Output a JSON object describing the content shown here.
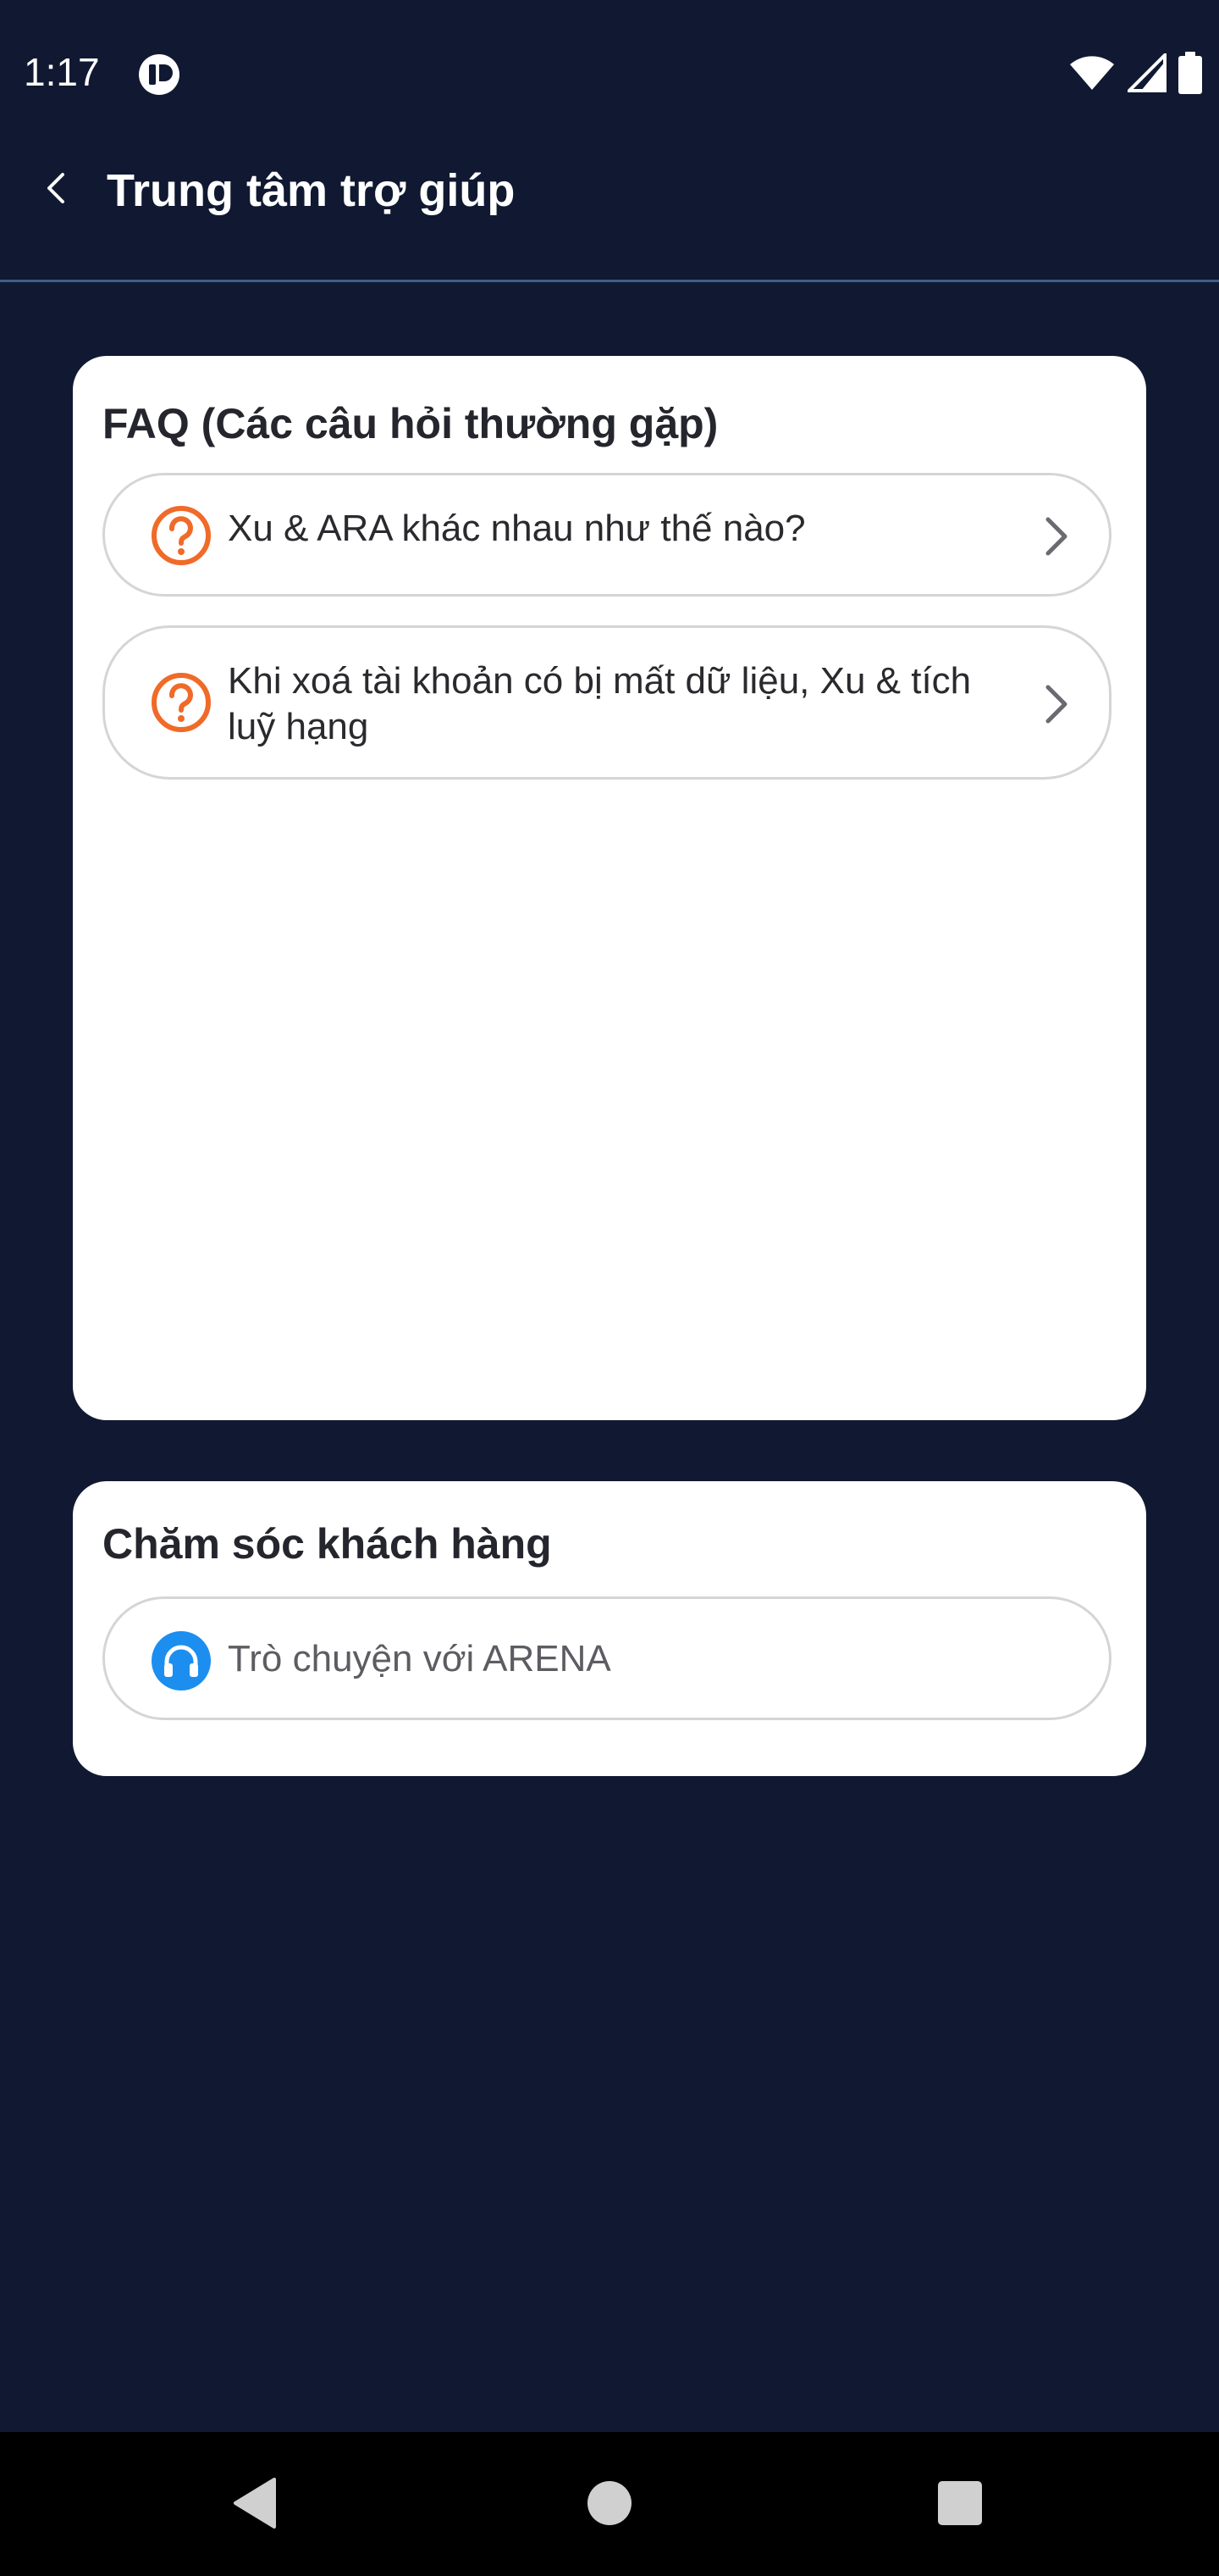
{
  "status_bar": {
    "time": "1:17",
    "icons": [
      "app-notification-icon",
      "wifi-icon",
      "cellular-signal-icon",
      "battery-icon"
    ]
  },
  "header": {
    "back_icon": "chevron-left-icon",
    "title": "Trung tâm trợ giúp"
  },
  "faq": {
    "title": "FAQ (Các câu hỏi thường gặp)",
    "items": [
      {
        "icon": "question-circle-icon",
        "label": "Xu & ARA khác nhau như thế nào?"
      },
      {
        "icon": "question-circle-icon",
        "label": "Khi xoá tài khoản có bị mất dữ liệu, Xu & tích luỹ hạng"
      }
    ]
  },
  "support": {
    "title": "Chăm sóc khách hàng",
    "items": [
      {
        "icon": "headset-icon",
        "label": "Trò chuyện với ARENA"
      }
    ]
  },
  "nav_bar": {
    "icons": [
      "back-triangle-icon",
      "home-circle-icon",
      "recents-square-icon"
    ]
  },
  "colors": {
    "background": "#101931",
    "card": "#ffffff",
    "question_icon": "#f06a28",
    "support_icon": "#1b8ef0",
    "divider": "#3f5f86"
  }
}
